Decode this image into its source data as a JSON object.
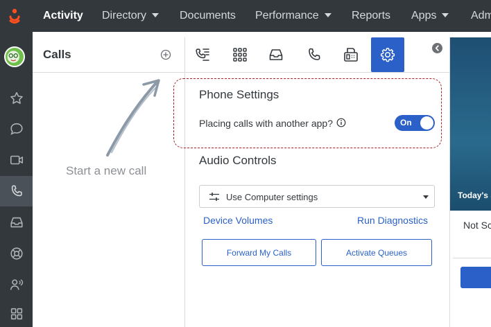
{
  "nav": {
    "items": [
      {
        "label": "Activity",
        "active": true,
        "dropdown": false
      },
      {
        "label": "Directory",
        "active": false,
        "dropdown": true
      },
      {
        "label": "Documents",
        "active": false,
        "dropdown": false
      },
      {
        "label": "Performance",
        "active": false,
        "dropdown": true
      },
      {
        "label": "Reports",
        "active": false,
        "dropdown": false
      },
      {
        "label": "Apps",
        "active": false,
        "dropdown": true
      },
      {
        "label": "Adm",
        "active": false,
        "dropdown": false
      }
    ]
  },
  "sidebar": {
    "icons": [
      "avatar",
      "star-icon",
      "chat-icon",
      "video-icon",
      "phone-icon",
      "inbox-icon",
      "help-icon",
      "contacts-icon",
      "apps-grid-icon"
    ],
    "active": "phone-icon"
  },
  "calls_panel": {
    "title": "Calls",
    "empty_hint": "Start a new call"
  },
  "tabs": {
    "items": [
      "call-list-icon",
      "dialpad-icon",
      "inbox-icon",
      "phone-icon",
      "fax-icon",
      "settings-icon"
    ],
    "active": "settings-icon"
  },
  "phone_settings": {
    "title": "Phone Settings",
    "placing_calls_label": "Placing calls with another app?",
    "toggle_label": "On",
    "toggle_on": true
  },
  "audio_controls": {
    "title": "Audio Controls",
    "select_value": "Use Computer settings",
    "device_volumes_link": "Device Volumes",
    "run_diagnostics_link": "Run Diagnostics",
    "forward_button": "Forward My Calls",
    "activate_queues_button": "Activate Queues"
  },
  "right_panel": {
    "banner_text": "Today's S",
    "status_text": "Not Sc"
  },
  "colors": {
    "accent": "#2a60c8",
    "nav_bg": "#33383d",
    "highlight_border": "#a51f24",
    "logo": "#ff4f1f"
  }
}
